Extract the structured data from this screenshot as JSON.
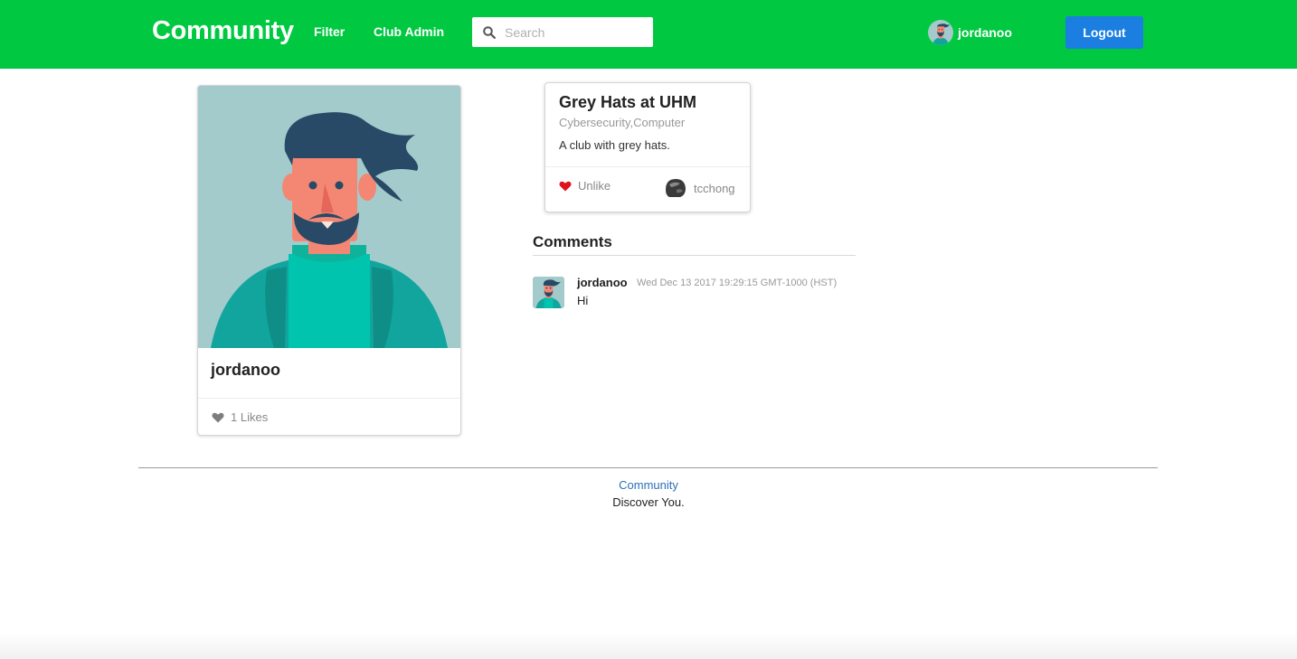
{
  "header": {
    "brand": "Community",
    "nav": [
      {
        "label": "Filter"
      },
      {
        "label": "Club Admin"
      }
    ],
    "search": {
      "placeholder": "Search",
      "value": ""
    },
    "user": {
      "name": "jordanoo",
      "icon": "avatar"
    },
    "logout_label": "Logout",
    "colors": {
      "bar": "#00c941",
      "logout": "#1a7fe0"
    }
  },
  "profile": {
    "name": "jordanoo",
    "likes_text": "1 Likes",
    "likes_icon": "heart-icon"
  },
  "club": {
    "title": "Grey Hats at UHM",
    "categories": "Cybersecurity,Computer",
    "description": "A club with grey hats.",
    "unlike_label": "Unlike",
    "owner": "tcchong",
    "heart_color": "#e0141e"
  },
  "comments": {
    "header": "Comments",
    "items": [
      {
        "author": "jordanoo",
        "date": "Wed Dec 13 2017 19:29:15 GMT-1000 (HST)",
        "text": "Hi"
      }
    ]
  },
  "footer": {
    "link": "Community",
    "tagline": "Discover You."
  }
}
